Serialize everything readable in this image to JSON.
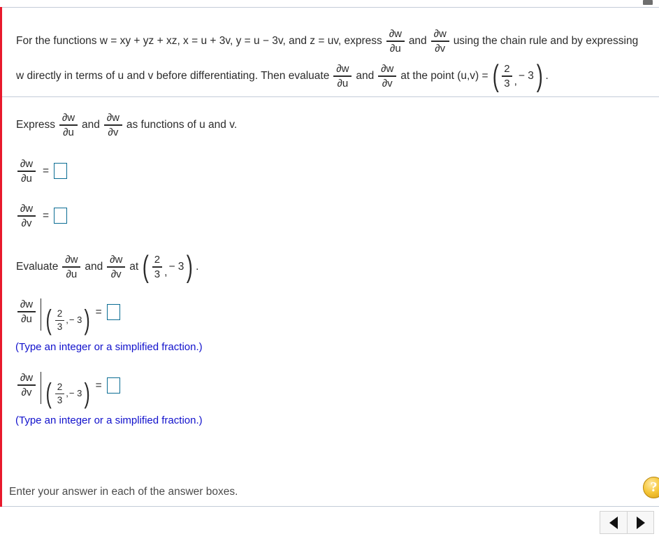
{
  "scrollbar": {
    "present": true
  },
  "prompt": {
    "line1_a": "For the functions w = xy + yz + xz, x = u + 3v, y = u − 3v, and z = uv, express",
    "line1_and": "and",
    "line1_b": "using the chain rule and by expressing",
    "line2_a": "w directly in terms of u and v before differentiating. Then evaluate",
    "line2_and": "and",
    "line2_b": "at the point (u,v) =",
    "line2_end": ".",
    "dwdu": {
      "num": "∂w",
      "den": "∂u"
    },
    "dwdv": {
      "num": "∂w",
      "den": "∂v"
    },
    "point": {
      "num": "2",
      "den": "3",
      "comma": ",",
      "second": "− 3"
    }
  },
  "express_section": {
    "lead": "Express",
    "and": "and",
    "tail": "as functions of u and v.",
    "equals": "=",
    "rows": [
      {
        "num": "∂w",
        "den": "∂u"
      },
      {
        "num": "∂w",
        "den": "∂v"
      }
    ]
  },
  "evaluate_section": {
    "lead": "Evaluate",
    "and": "and",
    "at": "at",
    "period": ".",
    "equals": "=",
    "point": {
      "num": "2",
      "den": "3",
      "comma": ",",
      "second": "− 3"
    },
    "rows": [
      {
        "num": "∂w",
        "den": "∂u",
        "hint": "(Type an integer or a simplified fraction.)"
      },
      {
        "num": "∂w",
        "den": "∂v",
        "hint": "(Type an integer or a simplified fraction.)"
      }
    ]
  },
  "footer": {
    "status": "Enter your answer in each of the answer boxes.",
    "help_label": "?",
    "prev_label": "◀",
    "next_label": "▶"
  },
  "colors": {
    "accent_rail": "#e8192c",
    "answer_box_border": "#0a6c93",
    "hint_text": "#1111cc",
    "divider": "#c3cbd8",
    "help_button": "#f5c637"
  }
}
